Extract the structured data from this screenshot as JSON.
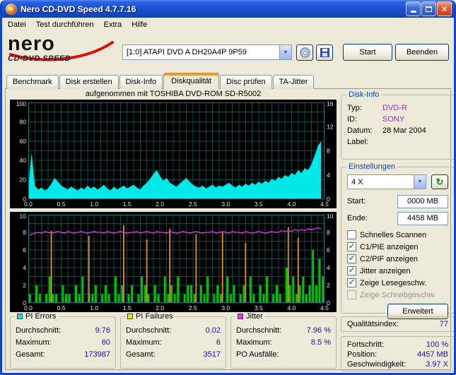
{
  "window": {
    "title": "Nero CD-DVD Speed 4.7.7.16"
  },
  "menu": {
    "items": [
      "Datei",
      "Test durchführen",
      "Extra",
      "Hilfe"
    ]
  },
  "logo": {
    "brand": "nero",
    "product": "CD-DVD SPEED",
    "swoosh_color": "#dd1010"
  },
  "toolbar": {
    "drive_value": "[1:0]  ATAPI DVD A  DH20A4P 9P59",
    "start_label": "Start",
    "quit_label": "Beenden"
  },
  "tabs": {
    "items": [
      "Benchmark",
      "Disk erstellen",
      "Disk-Info",
      "Diskqualität",
      "Disc prüfen",
      "TA-Jitter"
    ],
    "active_index": 3
  },
  "chart_header": "aufgenommen mit TOSHIBA DVD-ROM SD-R5002",
  "chart_data": [
    {
      "type": "area",
      "name": "PI Errors",
      "x_max": 4.5,
      "x_step": 0.05,
      "ylim": [
        0,
        100
      ],
      "grid_step_y": 10,
      "yticks": [
        0,
        20,
        40,
        60,
        80,
        100
      ],
      "y2lim": [
        0,
        16
      ],
      "y2ticks": [
        0,
        4,
        8,
        12,
        16
      ],
      "xticks": [
        "0.0",
        "0.5",
        "1.0",
        "1.5",
        "2.0",
        "2.5",
        "3.0",
        "3.5",
        "4.0",
        "4.5"
      ],
      "grid_color": "#0d4a4a",
      "border_color": "#0c7878",
      "series": [
        {
          "name": "PI Errors",
          "type": "area",
          "color": "#00e8e8",
          "values": [
            12,
            48,
            14,
            10,
            12,
            9,
            11,
            16,
            22,
            18,
            14,
            12,
            10,
            13,
            11,
            9,
            12,
            10,
            14,
            11,
            13,
            10,
            12,
            15,
            11,
            9,
            13,
            10,
            12,
            14,
            11,
            13,
            15,
            12,
            10,
            14,
            17,
            21,
            26,
            30,
            24,
            19,
            22,
            17,
            15,
            13,
            16,
            19,
            22,
            18,
            15,
            13,
            12,
            14,
            11,
            13,
            15,
            12,
            14,
            13,
            15,
            17,
            14,
            12,
            15,
            13,
            16,
            14,
            17,
            15,
            18,
            16,
            19,
            17,
            21,
            19,
            23,
            21,
            25,
            23,
            27,
            25,
            30,
            27,
            32,
            30,
            36,
            45,
            55,
            60
          ]
        }
      ]
    },
    {
      "type": "bar-line",
      "name": "PI Failures / Jitter",
      "x_max": 4.5,
      "x_step": 0.05,
      "ylim": [
        0,
        10
      ],
      "grid_step_y": 1,
      "yticks": [
        0,
        2,
        4,
        6,
        8,
        10
      ],
      "y2lim": [
        0,
        10
      ],
      "y2ticks": [
        0,
        2,
        4,
        6,
        8,
        10
      ],
      "xticks": [
        "0.0",
        "0.5",
        "1.0",
        "1.5",
        "2.0",
        "2.5",
        "3.0",
        "3.5",
        "4.0",
        "4.5"
      ],
      "grid_color": "#0d4a4a",
      "border_color": "#0c7878",
      "series": [
        {
          "name": "PI Failures",
          "type": "bar",
          "color": "#00c400",
          "values": [
            1,
            0,
            2,
            1,
            0,
            1,
            3,
            1,
            1,
            0,
            2,
            1,
            1,
            0,
            2,
            1,
            3,
            0,
            1,
            1,
            2,
            0,
            1,
            2,
            1,
            0,
            3,
            1,
            2,
            0,
            1,
            2,
            0,
            1,
            3,
            2,
            1,
            0,
            2,
            1,
            0,
            3,
            1,
            2,
            1,
            3,
            0,
            1,
            2,
            2,
            1,
            0,
            2,
            1,
            3,
            0,
            1,
            2,
            1,
            0,
            3,
            1,
            2,
            0,
            1,
            2,
            0,
            3,
            1,
            0,
            2,
            1,
            3,
            0,
            1,
            2,
            1,
            0,
            4,
            2,
            3,
            1,
            2,
            3,
            1,
            2,
            6,
            2,
            5,
            3
          ]
        },
        {
          "name": "Spikes",
          "type": "spikes",
          "color": "#d4861c",
          "points": [
            {
              "x": 0.35,
              "v": 8.2
            },
            {
              "x": 0.92,
              "v": 7.6
            },
            {
              "x": 1.45,
              "v": 8.8
            },
            {
              "x": 1.8,
              "v": 7.2
            },
            {
              "x": 2.15,
              "v": 8.4
            },
            {
              "x": 2.55,
              "v": 7.8
            },
            {
              "x": 2.95,
              "v": 8.0
            },
            {
              "x": 3.3,
              "v": 6.8
            },
            {
              "x": 3.95,
              "v": 8.6
            },
            {
              "x": 4.1,
              "v": 7.4
            }
          ]
        },
        {
          "name": "Jitter",
          "type": "line",
          "color": "#ff2bff",
          "values": [
            7.6,
            7.8,
            7.9,
            8.0,
            7.9,
            8.1,
            8.0,
            7.9,
            8.0,
            8.1,
            8.0,
            7.9,
            8.1,
            8.0,
            7.9,
            8.0,
            8.1,
            8.0,
            7.9,
            8.0,
            8.1,
            8.0,
            8.0,
            7.9,
            8.1,
            8.0,
            7.9,
            8.0,
            8.1,
            8.0,
            7.9,
            8.0,
            8.0,
            8.1,
            7.9,
            8.0,
            8.1,
            8.0,
            7.9,
            8.1,
            8.0,
            8.0,
            7.9,
            8.1,
            8.0,
            7.9,
            8.0,
            8.1,
            8.0,
            7.9,
            8.0,
            8.1,
            8.0,
            7.9,
            8.0,
            8.0,
            8.1,
            7.9,
            8.0,
            8.1,
            8.0,
            7.9,
            8.1,
            8.0,
            8.0,
            7.9,
            8.1,
            8.0,
            7.9,
            8.0,
            8.1,
            8.0,
            7.9,
            8.0,
            8.1,
            8.0,
            8.0,
            8.2,
            8.1,
            8.2,
            8.1,
            8.3,
            8.2,
            8.3,
            8.2,
            8.4,
            8.3,
            8.4,
            8.5,
            8.4
          ]
        }
      ]
    }
  ],
  "disk_info": {
    "title": "Disk-Info",
    "rows": [
      {
        "label": "Typ:",
        "value": "DVD-R",
        "accent": true
      },
      {
        "label": "ID:",
        "value": "SONY",
        "accent": true
      },
      {
        "label": "Datum:",
        "value": "28 Mar 2004",
        "accent": false
      },
      {
        "label": "Label:",
        "value": "",
        "accent": false
      }
    ]
  },
  "settings": {
    "title": "Einstellungen",
    "speed_value": "4 X",
    "start_label": "Start:",
    "start_value": "0000 MB",
    "end_label": "Ende:",
    "end_value": "4458 MB",
    "checkboxes": [
      {
        "label": "Schnelles Scannen",
        "checked": false,
        "disabled": false
      },
      {
        "label": "C1/PIE anzeigen",
        "checked": true,
        "disabled": false
      },
      {
        "label": "C2/PIF anzeigen",
        "checked": true,
        "disabled": false
      },
      {
        "label": "Jitter anzeigen",
        "checked": true,
        "disabled": false
      },
      {
        "label": "Zeige Lesegeschw.",
        "checked": true,
        "disabled": false
      },
      {
        "label": "Zeige Schreibgeschw.",
        "checked": false,
        "disabled": true
      }
    ],
    "advanced_label": "Erweitert"
  },
  "quality": {
    "label": "Qualitätsindex:",
    "value": "77"
  },
  "progress": {
    "rows": [
      {
        "label": "Fortschritt:",
        "value": "100 %"
      },
      {
        "label": "Position:",
        "value": "4457 MB"
      },
      {
        "label": "Geschwindigkeit:",
        "value": "3.97 X"
      }
    ]
  },
  "stats": [
    {
      "title": "PI Errors",
      "color": "#00e8e8",
      "rows": [
        [
          "Durchschnitt:",
          "9.76"
        ],
        [
          "Maximum:",
          "60"
        ],
        [
          "Gesamt:",
          "173987"
        ]
      ]
    },
    {
      "title": "PI Failures",
      "color": "#e8e800",
      "rows": [
        [
          "Durchschnitt:",
          "0.02"
        ],
        [
          "Maximum:",
          "6"
        ],
        [
          "Gesamt:",
          "3517"
        ]
      ]
    },
    {
      "title": "Jitter",
      "color": "#ff2bff",
      "rows": [
        [
          "Durchschnitt:",
          "7.96 %"
        ],
        [
          "Maximum:",
          "8.5 %"
        ],
        [
          "PO Ausfälle:",
          ""
        ]
      ]
    }
  ]
}
